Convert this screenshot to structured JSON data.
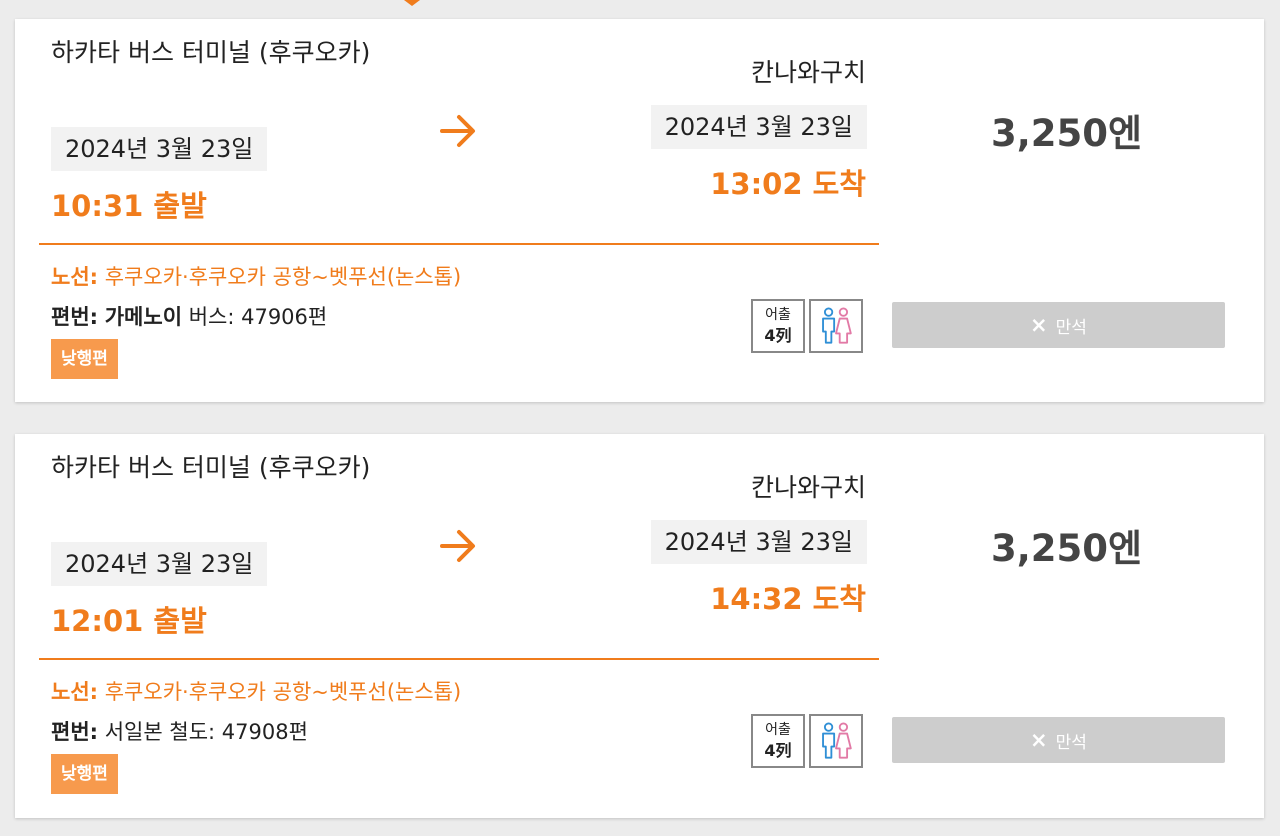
{
  "trips": [
    {
      "departure": {
        "station": "하카타 버스 터미널 (후쿠오카)",
        "date": "2024년 3월 23일",
        "time": "10:31 출발"
      },
      "arrival": {
        "station": "칸나와구치",
        "date": "2024년 3월 23일",
        "time": "13:02 도착"
      },
      "price": "3,250엔",
      "route": {
        "label": "노선:",
        "value": "후쿠오카·후쿠오카 공항~벳푸선(논스톱)"
      },
      "flight": {
        "label": "편번:",
        "company": "가메노이",
        "value": "버스: 47906편"
      },
      "badge": "낮행편",
      "seat_icon": {
        "line1": "어출",
        "line2": "4列"
      },
      "status": {
        "icon": "×",
        "label": "만석"
      }
    },
    {
      "departure": {
        "station": "하카타 버스 터미널 (후쿠오카)",
        "date": "2024년 3월 23일",
        "time": "12:01 출발"
      },
      "arrival": {
        "station": "칸나와구치",
        "date": "2024년 3월 23일",
        "time": "14:32 도착"
      },
      "price": "3,250엔",
      "route": {
        "label": "노선:",
        "value": "후쿠오카·후쿠오카 공항~벳푸선(논스톱)"
      },
      "flight": {
        "label": "편번:",
        "company": "",
        "value": "서일본 철도: 47908편"
      },
      "badge": "낮행편",
      "seat_icon": {
        "line1": "어출",
        "line2": "4列"
      },
      "status": {
        "icon": "×",
        "label": "만석"
      }
    }
  ],
  "colors": {
    "accent": "#f07c1c",
    "badge": "#f79a4d",
    "sold_out": "#cdcdcd"
  }
}
